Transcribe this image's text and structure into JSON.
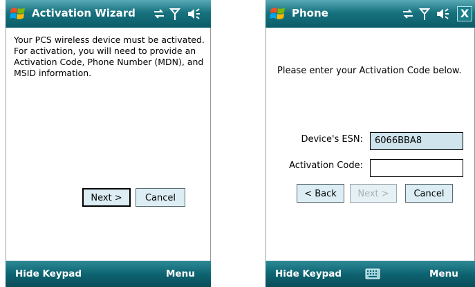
{
  "left": {
    "title": "Activation Wizard",
    "message_lines": [
      "Your PCS wireless device must be activated.",
      "For activation, you will need to provide an",
      "Activation Code, Phone Number (MDN), and",
      "MSID information."
    ],
    "next_label": "Next >",
    "cancel_label": "Cancel",
    "softkey_left": "Hide Keypad",
    "softkey_right": "Menu",
    "icons": [
      "windows-flag-icon",
      "connectivity-icon",
      "signal-antenna-icon",
      "volume-icon"
    ]
  },
  "right": {
    "title": "Phone",
    "message": "Please enter your Activation Code below.",
    "esn_label": "Device's ESN:",
    "esn_value": "6066BBA8",
    "activation_label": "Activation Code:",
    "activation_value": "",
    "back_label": "< Back",
    "next_label": "Next >",
    "cancel_label": "Cancel",
    "softkey_left": "Hide Keypad",
    "softkey_right": "Menu",
    "close_label": "X",
    "icons": [
      "windows-flag-icon",
      "connectivity-icon",
      "signal-antenna-icon",
      "volume-icon",
      "close-icon",
      "keyboard-icon"
    ]
  }
}
